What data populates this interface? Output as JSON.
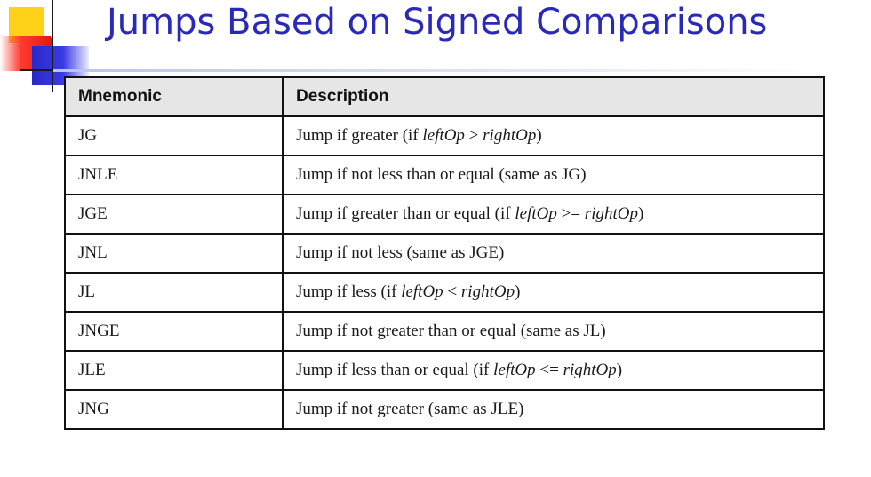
{
  "slide": {
    "title": "Jumps Based on Signed Comparisons"
  },
  "table": {
    "headers": {
      "mnemonic": "Mnemonic",
      "description": "Description"
    },
    "rows": [
      {
        "mnemonic": "JG",
        "desc_pre": "Jump if greater (if ",
        "left_op": "leftOp",
        "op": " > ",
        "right_op": "rightOp",
        "desc_post": ")"
      },
      {
        "mnemonic": "JNLE",
        "desc_pre": "Jump if not less than or equal (same as JG)",
        "left_op": "",
        "op": "",
        "right_op": "",
        "desc_post": ""
      },
      {
        "mnemonic": "JGE",
        "desc_pre": "Jump if greater than or equal (if ",
        "left_op": "leftOp",
        "op": " >= ",
        "right_op": "rightOp",
        "desc_post": ")"
      },
      {
        "mnemonic": "JNL",
        "desc_pre": "Jump if not less (same as JGE)",
        "left_op": "",
        "op": "",
        "right_op": "",
        "desc_post": ""
      },
      {
        "mnemonic": "JL",
        "desc_pre": "Jump if less (if ",
        "left_op": "leftOp",
        "op": " < ",
        "right_op": "rightOp",
        "desc_post": ")"
      },
      {
        "mnemonic": "JNGE",
        "desc_pre": "Jump if not greater than or equal (same as JL)",
        "left_op": "",
        "op": "",
        "right_op": "",
        "desc_post": ""
      },
      {
        "mnemonic": "JLE",
        "desc_pre": "Jump if less than or equal (if ",
        "left_op": "leftOp",
        "op": " <= ",
        "right_op": "rightOp",
        "desc_post": ")"
      },
      {
        "mnemonic": "JNG",
        "desc_pre": "Jump if not greater (same as JLE)",
        "left_op": "",
        "op": "",
        "right_op": "",
        "desc_post": ""
      }
    ]
  },
  "colors": {
    "title": "#2a2ab8",
    "header_bg": "#e6e6e6",
    "border": "#111111"
  },
  "icons": {
    "logo": "slide-corner-logo"
  }
}
